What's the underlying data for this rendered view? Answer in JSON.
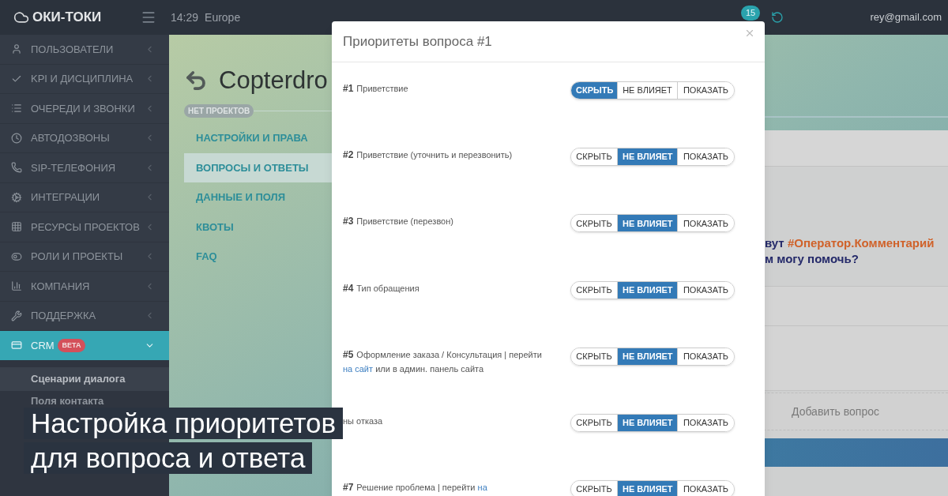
{
  "topbar": {
    "logo": "ОКИ-ТОКИ",
    "time": "14:29",
    "zone": "Europe",
    "notification_count": "15",
    "user_email": "rey@gmail.com"
  },
  "sidebar": {
    "items": [
      {
        "label": "ПОЛЬЗОВАТЕЛИ",
        "selected": false
      },
      {
        "label": "KPI И ДИСЦИПЛИНА",
        "selected": false
      },
      {
        "label": "ОЧЕРЕДИ И ЗВОНКИ",
        "selected": false
      },
      {
        "label": "АВТОДОЗВОНЫ",
        "selected": false
      },
      {
        "label": "SIP-ТЕЛЕФОНИЯ",
        "selected": false
      },
      {
        "label": "ИНТЕГРАЦИИ",
        "selected": false
      },
      {
        "label": "РЕСУРСЫ ПРОЕКТОВ",
        "selected": false
      },
      {
        "label": "РОЛИ И ПРОЕКТЫ",
        "selected": false
      },
      {
        "label": "КОМПАНИЯ",
        "selected": false
      },
      {
        "label": "ПОДДЕРЖКА",
        "selected": false
      },
      {
        "label": "CRM",
        "badge": "BETA",
        "selected": true
      }
    ],
    "subitems": [
      {
        "label": "Сценарии диалога",
        "selected": true
      },
      {
        "label": "Поля контакта",
        "selected": false
      }
    ]
  },
  "project": {
    "title": "Copterdro",
    "badge": "НЕТ ПРОЕКТОВ",
    "nav": [
      {
        "label": "НАСТРОЙКИ И ПРАВА",
        "selected": false
      },
      {
        "label": "ВОПРОСЫ И ОТВЕТЫ",
        "selected": true
      },
      {
        "label": "ДАННЫЕ И ПОЛЯ",
        "selected": false
      },
      {
        "label": "КВОТЫ",
        "selected": false
      },
      {
        "label": "FAQ",
        "selected": false
      }
    ]
  },
  "script_preview": {
    "line_1_start": "вут ",
    "line_1_variable": "#Оператор.Комментарий",
    "line_2": "м могу помочь?",
    "add_question": "Добавить вопрос"
  },
  "modal": {
    "title": "Приоритеты вопроса #1",
    "rows": [
      {
        "number": "#1",
        "label": [
          {
            "text": "Приветствие",
            "link": false
          }
        ],
        "options": [
          {
            "label": "СКРЫТЬ",
            "selected": true
          },
          {
            "label": "НЕ ВЛИЯЕТ",
            "selected": false
          },
          {
            "label": "ПОКАЗАТЬ",
            "selected": false
          }
        ]
      },
      {
        "number": "#2",
        "label": [
          {
            "text": "Приветствие (уточнить и перезвонить)",
            "link": false
          }
        ],
        "options": [
          {
            "label": "СКРЫТЬ",
            "selected": false
          },
          {
            "label": "НЕ ВЛИЯЕТ",
            "selected": true
          },
          {
            "label": "ПОКАЗАТЬ",
            "selected": false
          }
        ]
      },
      {
        "number": "#3",
        "label": [
          {
            "text": "Приветствие (перезвон)",
            "link": false
          }
        ],
        "options": [
          {
            "label": "СКРЫТЬ",
            "selected": false
          },
          {
            "label": "НЕ ВЛИЯЕТ",
            "selected": true
          },
          {
            "label": "ПОКАЗАТЬ",
            "selected": false
          }
        ]
      },
      {
        "number": "#4",
        "label": [
          {
            "text": "Тип обращения",
            "link": false
          }
        ],
        "options": [
          {
            "label": "СКРЫТЬ",
            "selected": false
          },
          {
            "label": "НЕ ВЛИЯЕТ",
            "selected": true
          },
          {
            "label": "ПОКАЗАТЬ",
            "selected": false
          }
        ]
      },
      {
        "number": "#5",
        "label": [
          {
            "text": "Оформление заказа / Консультация | перейти",
            "link": false
          },
          {
            "text": "на сайт",
            "link": true
          },
          {
            "text": "или в админ. панель сайта",
            "link": false
          }
        ],
        "options": [
          {
            "label": "СКРЫТЬ",
            "selected": false
          },
          {
            "label": "НЕ ВЛИЯЕТ",
            "selected": true
          },
          {
            "label": "ПОКАЗАТЬ",
            "selected": false
          }
        ]
      },
      {
        "label": [
          {
            "text": "ны отказа",
            "link": false
          }
        ],
        "options": [
          {
            "label": "СКРЫТЬ",
            "selected": false
          },
          {
            "label": "НЕ ВЛИЯЕТ",
            "selected": true
          },
          {
            "label": "ПОКАЗАТЬ",
            "selected": false
          }
        ]
      },
      {
        "number": "#7",
        "label": [
          {
            "text": "Решение проблема |  перейти",
            "link": false
          },
          {
            "text": "на",
            "link": true
          }
        ],
        "options": [
          {
            "label": "СКРЫТЬ",
            "selected": false
          },
          {
            "label": "НЕ ВЛИЯЕТ",
            "selected": true
          },
          {
            "label": "ПОКАЗАТЬ",
            "selected": false
          }
        ]
      }
    ]
  },
  "caption": {
    "lines": [
      "Настройка приоритетов",
      "для вопроса и ответа"
    ]
  }
}
